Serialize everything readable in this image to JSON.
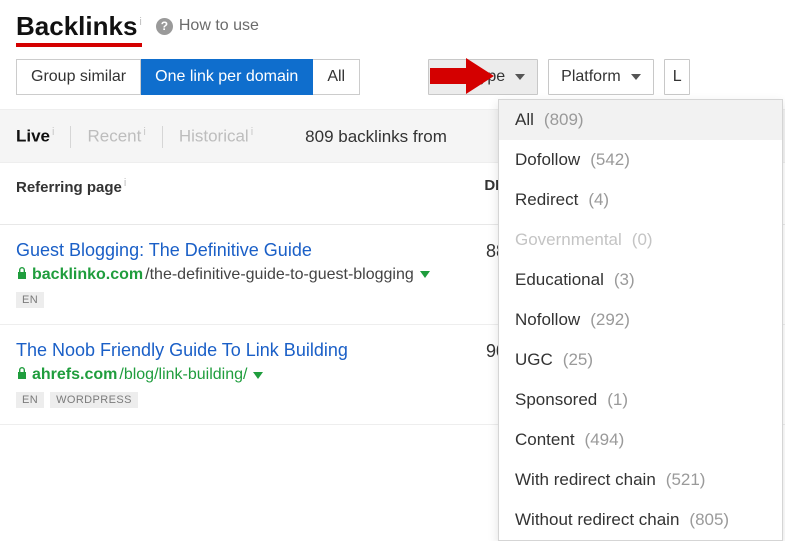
{
  "header": {
    "title": "Backlinks",
    "how_to_use": "How to use"
  },
  "grouping": {
    "options": [
      "Group similar",
      "One link per domain",
      "All"
    ],
    "active_index": 1
  },
  "filters": {
    "link_type": {
      "label": "Link type"
    },
    "platform": {
      "label": "Platform"
    },
    "extra": {
      "partial_label": "L"
    }
  },
  "link_type_menu": [
    {
      "label": "All",
      "count": "(809)"
    },
    {
      "label": "Dofollow",
      "count": "(542)"
    },
    {
      "label": "Redirect",
      "count": "(4)"
    },
    {
      "label": "Governmental",
      "count": "(0)",
      "disabled": true
    },
    {
      "label": "Educational",
      "count": "(3)"
    },
    {
      "label": "Nofollow",
      "count": "(292)"
    },
    {
      "label": "UGC",
      "count": "(25)"
    },
    {
      "label": "Sponsored",
      "count": "(1)"
    },
    {
      "label": "Content",
      "count": "(494)"
    },
    {
      "label": "With redirect chain",
      "count": "(521)"
    },
    {
      "label": "Without redirect chain",
      "count": "(805)"
    }
  ],
  "tabs": {
    "items": [
      "Live",
      "Recent",
      "Historical"
    ],
    "active_index": 0,
    "summary_prefix": "809 backlinks from"
  },
  "columns": {
    "referring_page": "Referring page",
    "dr": "DR"
  },
  "rows": [
    {
      "title": "Guest Blogging: The Definitive Guide",
      "domain": "backlinko.com",
      "path": "/the-definitive-guide-to-guest-blogging",
      "path_green": false,
      "dr": "88",
      "tags": [
        "EN"
      ]
    },
    {
      "title": "The Noob Friendly Guide To Link Building",
      "domain": "ahrefs.com",
      "path": "/blog/link-building/",
      "path_green": true,
      "dr": "90",
      "tags": [
        "EN",
        "WORDPRESS"
      ]
    }
  ]
}
